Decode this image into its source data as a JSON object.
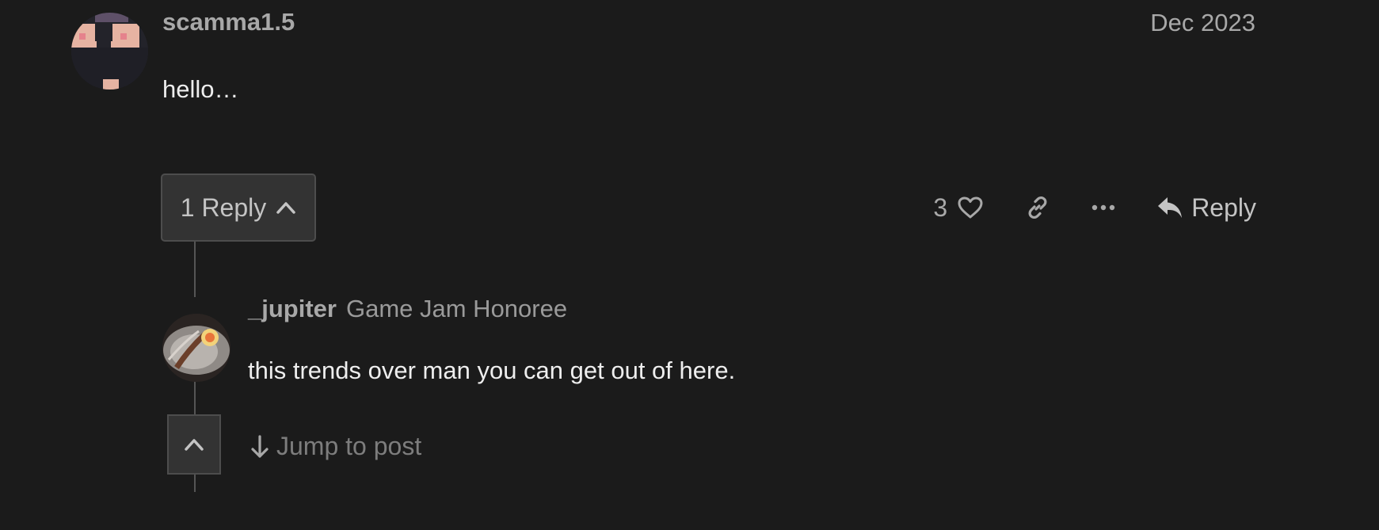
{
  "post": {
    "username": "scamma1.5",
    "date": "Dec 2023",
    "body": "hello…",
    "avatar_icon": "pixel-face-avatar"
  },
  "replies_toggle": {
    "label": "1 Reply",
    "icon": "chevron-up-icon"
  },
  "actions": {
    "like_count": "3",
    "like_icon": "heart-icon",
    "link_icon": "link-icon",
    "more_icon": "ellipsis-icon",
    "reply_icon": "reply-arrow-icon",
    "reply_label": "Reply"
  },
  "embedded_reply": {
    "username": "_jupiter",
    "user_title": "Game Jam Honoree",
    "body": "this trends over man you can get out of here.",
    "avatar_icon": "photo-avatar"
  },
  "bottom": {
    "collapse_icon": "chevron-up-icon",
    "jump_label": "Jump to post",
    "jump_icon": "arrow-down-icon"
  },
  "colors": {
    "background": "#1b1b1b",
    "muted_text": "#a8a8a8",
    "body_text": "#eeeeee",
    "button_bg": "#333333"
  }
}
